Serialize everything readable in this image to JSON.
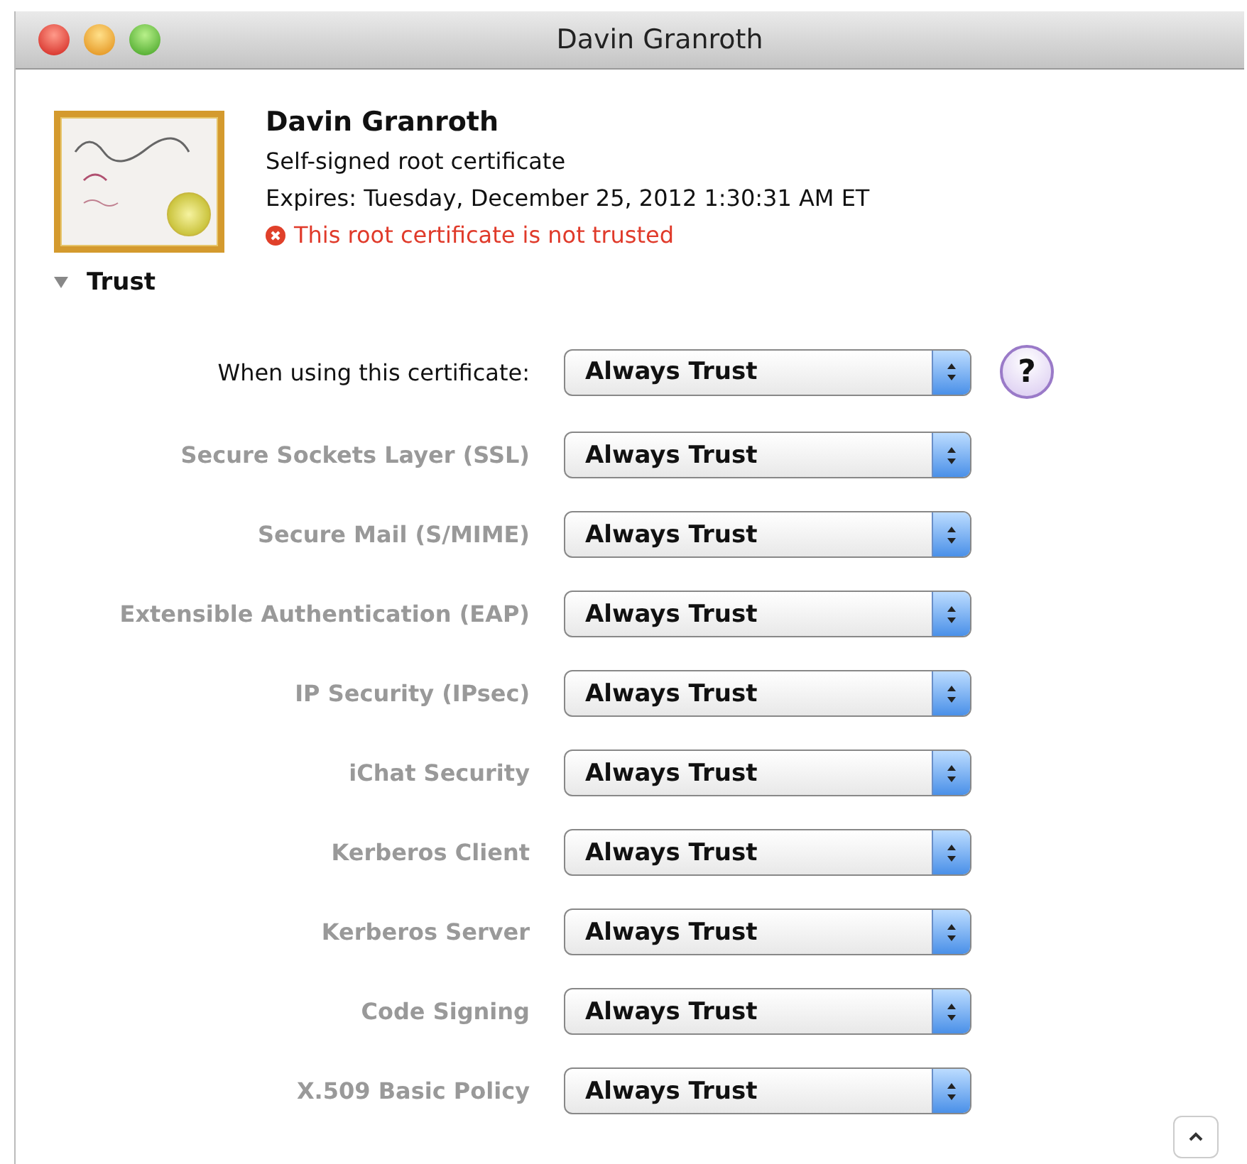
{
  "window": {
    "title": "Davin Granroth"
  },
  "certificate": {
    "name": "Davin Granroth",
    "type": "Self-signed root certificate",
    "expires": "Expires: Tuesday, December 25, 2012 1:30:31 AM ET",
    "status": "This root certificate is not trusted",
    "trusted": false
  },
  "trust_section": {
    "title": "Trust",
    "expanded": true,
    "main_row": {
      "label": "When using this certificate:",
      "value": "Always Trust",
      "disabled": false
    },
    "help": "?",
    "rows": [
      {
        "label": "Secure Sockets Layer (SSL)",
        "value": "Always Trust",
        "disabled": true
      },
      {
        "label": "Secure Mail (S/MIME)",
        "value": "Always Trust",
        "disabled": true
      },
      {
        "label": "Extensible Authentication (EAP)",
        "value": "Always Trust",
        "disabled": true
      },
      {
        "label": "IP Security (IPsec)",
        "value": "Always Trust",
        "disabled": true
      },
      {
        "label": "iChat Security",
        "value": "Always Trust",
        "disabled": true
      },
      {
        "label": "Kerberos Client",
        "value": "Always Trust",
        "disabled": true
      },
      {
        "label": "Kerberos Server",
        "value": "Always Trust",
        "disabled": true
      },
      {
        "label": "Code Signing",
        "value": "Always Trust",
        "disabled": true
      },
      {
        "label": "X.509 Basic Policy",
        "value": "Always Trust",
        "disabled": true
      }
    ]
  }
}
